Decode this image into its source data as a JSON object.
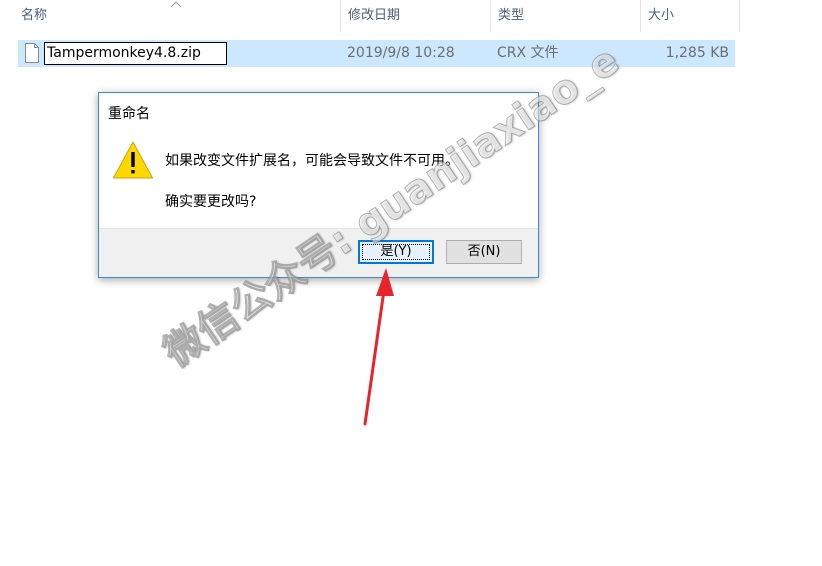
{
  "columns": {
    "name": "名称",
    "modified": "修改日期",
    "type": "类型",
    "size": "大小"
  },
  "file": {
    "name_editing": "Tampermonkey4.8.zip",
    "modified": "2019/9/8 10:28",
    "type": "CRX 文件",
    "size": "1,285 KB"
  },
  "dialog": {
    "title": "重命名",
    "message_line1": "如果改变文件扩展名，可能会导致文件不可用。",
    "message_line2": "确实要更改吗?",
    "yes_label": "是(Y)",
    "no_label": "否(N)"
  },
  "watermark": {
    "text": "微信公众号: guanjiaxiao_e"
  },
  "colors": {
    "selection": "#cce8ff",
    "dialog_border": "#3c8bd6",
    "primary_button_border": "#0078d7",
    "annotation_arrow": "#e8242b",
    "warning_yellow": "#ffd800"
  },
  "icons": {
    "sort": "chevron-up-icon",
    "file": "file-icon",
    "warning": "warning-icon",
    "arrow": "annotation-arrow"
  }
}
